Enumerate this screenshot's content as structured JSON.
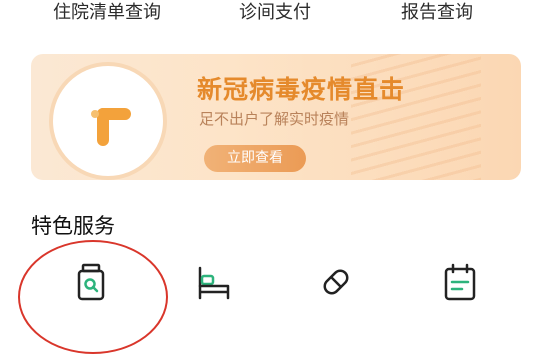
{
  "top_menu": [
    {
      "label": "住院清单查询"
    },
    {
      "label": "诊间支付"
    },
    {
      "label": "报告查询"
    }
  ],
  "banner": {
    "title": "新冠病毒疫情直击",
    "subtitle": "足不出户了解实时疫情",
    "button": "立即查看"
  },
  "section": {
    "title": "特色服务"
  },
  "services": [
    {
      "icon": "medicine-bottle-icon"
    },
    {
      "icon": "bed-icon"
    },
    {
      "icon": "pill-capsule-icon"
    },
    {
      "icon": "calendar-icon"
    }
  ],
  "colors": {
    "banner_accent": "#e58a2c",
    "annotation_circle": "#d9362b"
  }
}
